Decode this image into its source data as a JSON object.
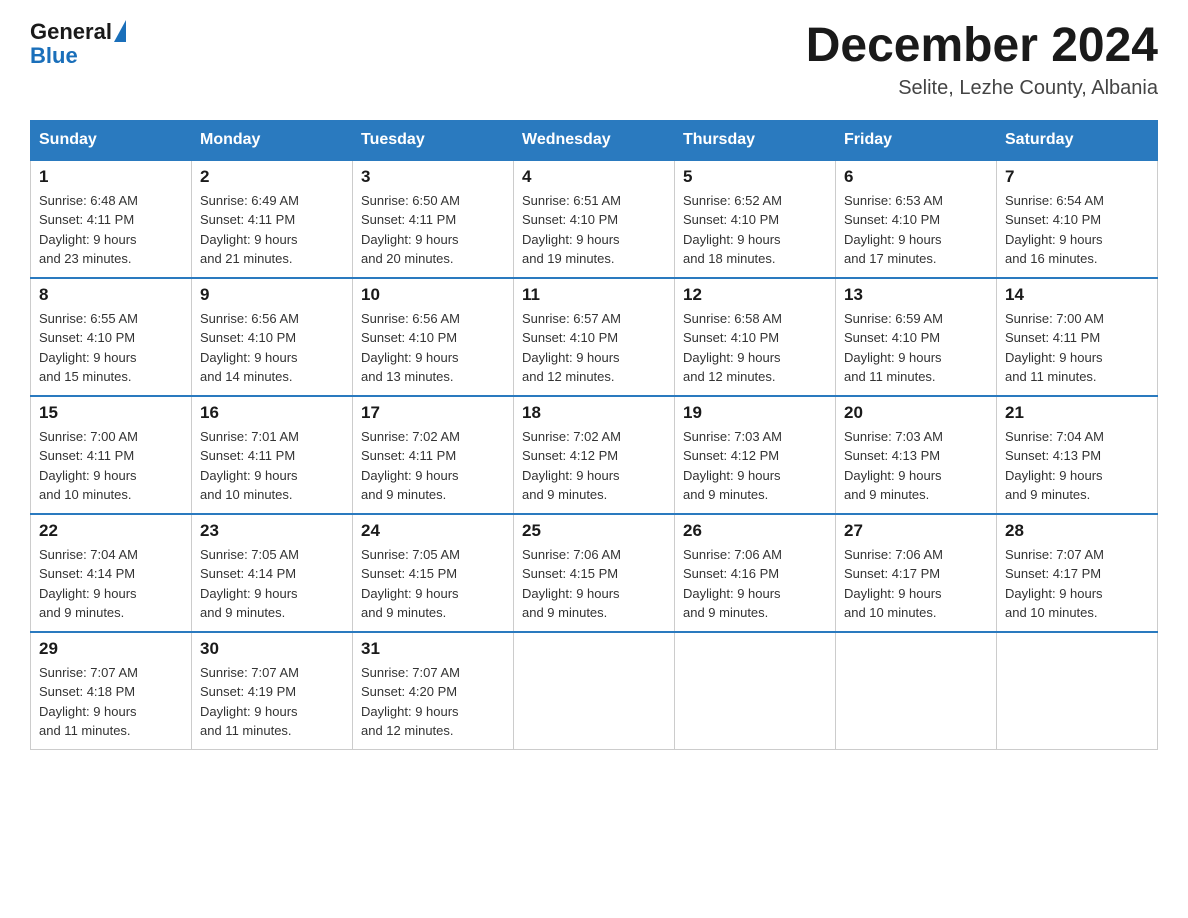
{
  "header": {
    "logo_general": "General",
    "logo_blue": "Blue",
    "month_title": "December 2024",
    "location": "Selite, Lezhe County, Albania"
  },
  "days_of_week": [
    "Sunday",
    "Monday",
    "Tuesday",
    "Wednesday",
    "Thursday",
    "Friday",
    "Saturday"
  ],
  "weeks": [
    [
      {
        "day": "1",
        "sunrise": "6:48 AM",
        "sunset": "4:11 PM",
        "daylight": "9 hours and 23 minutes."
      },
      {
        "day": "2",
        "sunrise": "6:49 AM",
        "sunset": "4:11 PM",
        "daylight": "9 hours and 21 minutes."
      },
      {
        "day": "3",
        "sunrise": "6:50 AM",
        "sunset": "4:11 PM",
        "daylight": "9 hours and 20 minutes."
      },
      {
        "day": "4",
        "sunrise": "6:51 AM",
        "sunset": "4:10 PM",
        "daylight": "9 hours and 19 minutes."
      },
      {
        "day": "5",
        "sunrise": "6:52 AM",
        "sunset": "4:10 PM",
        "daylight": "9 hours and 18 minutes."
      },
      {
        "day": "6",
        "sunrise": "6:53 AM",
        "sunset": "4:10 PM",
        "daylight": "9 hours and 17 minutes."
      },
      {
        "day": "7",
        "sunrise": "6:54 AM",
        "sunset": "4:10 PM",
        "daylight": "9 hours and 16 minutes."
      }
    ],
    [
      {
        "day": "8",
        "sunrise": "6:55 AM",
        "sunset": "4:10 PM",
        "daylight": "9 hours and 15 minutes."
      },
      {
        "day": "9",
        "sunrise": "6:56 AM",
        "sunset": "4:10 PM",
        "daylight": "9 hours and 14 minutes."
      },
      {
        "day": "10",
        "sunrise": "6:56 AM",
        "sunset": "4:10 PM",
        "daylight": "9 hours and 13 minutes."
      },
      {
        "day": "11",
        "sunrise": "6:57 AM",
        "sunset": "4:10 PM",
        "daylight": "9 hours and 12 minutes."
      },
      {
        "day": "12",
        "sunrise": "6:58 AM",
        "sunset": "4:10 PM",
        "daylight": "9 hours and 12 minutes."
      },
      {
        "day": "13",
        "sunrise": "6:59 AM",
        "sunset": "4:10 PM",
        "daylight": "9 hours and 11 minutes."
      },
      {
        "day": "14",
        "sunrise": "7:00 AM",
        "sunset": "4:11 PM",
        "daylight": "9 hours and 11 minutes."
      }
    ],
    [
      {
        "day": "15",
        "sunrise": "7:00 AM",
        "sunset": "4:11 PM",
        "daylight": "9 hours and 10 minutes."
      },
      {
        "day": "16",
        "sunrise": "7:01 AM",
        "sunset": "4:11 PM",
        "daylight": "9 hours and 10 minutes."
      },
      {
        "day": "17",
        "sunrise": "7:02 AM",
        "sunset": "4:11 PM",
        "daylight": "9 hours and 9 minutes."
      },
      {
        "day": "18",
        "sunrise": "7:02 AM",
        "sunset": "4:12 PM",
        "daylight": "9 hours and 9 minutes."
      },
      {
        "day": "19",
        "sunrise": "7:03 AM",
        "sunset": "4:12 PM",
        "daylight": "9 hours and 9 minutes."
      },
      {
        "day": "20",
        "sunrise": "7:03 AM",
        "sunset": "4:13 PM",
        "daylight": "9 hours and 9 minutes."
      },
      {
        "day": "21",
        "sunrise": "7:04 AM",
        "sunset": "4:13 PM",
        "daylight": "9 hours and 9 minutes."
      }
    ],
    [
      {
        "day": "22",
        "sunrise": "7:04 AM",
        "sunset": "4:14 PM",
        "daylight": "9 hours and 9 minutes."
      },
      {
        "day": "23",
        "sunrise": "7:05 AM",
        "sunset": "4:14 PM",
        "daylight": "9 hours and 9 minutes."
      },
      {
        "day": "24",
        "sunrise": "7:05 AM",
        "sunset": "4:15 PM",
        "daylight": "9 hours and 9 minutes."
      },
      {
        "day": "25",
        "sunrise": "7:06 AM",
        "sunset": "4:15 PM",
        "daylight": "9 hours and 9 minutes."
      },
      {
        "day": "26",
        "sunrise": "7:06 AM",
        "sunset": "4:16 PM",
        "daylight": "9 hours and 9 minutes."
      },
      {
        "day": "27",
        "sunrise": "7:06 AM",
        "sunset": "4:17 PM",
        "daylight": "9 hours and 10 minutes."
      },
      {
        "day": "28",
        "sunrise": "7:07 AM",
        "sunset": "4:17 PM",
        "daylight": "9 hours and 10 minutes."
      }
    ],
    [
      {
        "day": "29",
        "sunrise": "7:07 AM",
        "sunset": "4:18 PM",
        "daylight": "9 hours and 11 minutes."
      },
      {
        "day": "30",
        "sunrise": "7:07 AM",
        "sunset": "4:19 PM",
        "daylight": "9 hours and 11 minutes."
      },
      {
        "day": "31",
        "sunrise": "7:07 AM",
        "sunset": "4:20 PM",
        "daylight": "9 hours and 12 minutes."
      },
      null,
      null,
      null,
      null
    ]
  ],
  "labels": {
    "sunrise": "Sunrise:",
    "sunset": "Sunset:",
    "daylight": "Daylight:"
  }
}
